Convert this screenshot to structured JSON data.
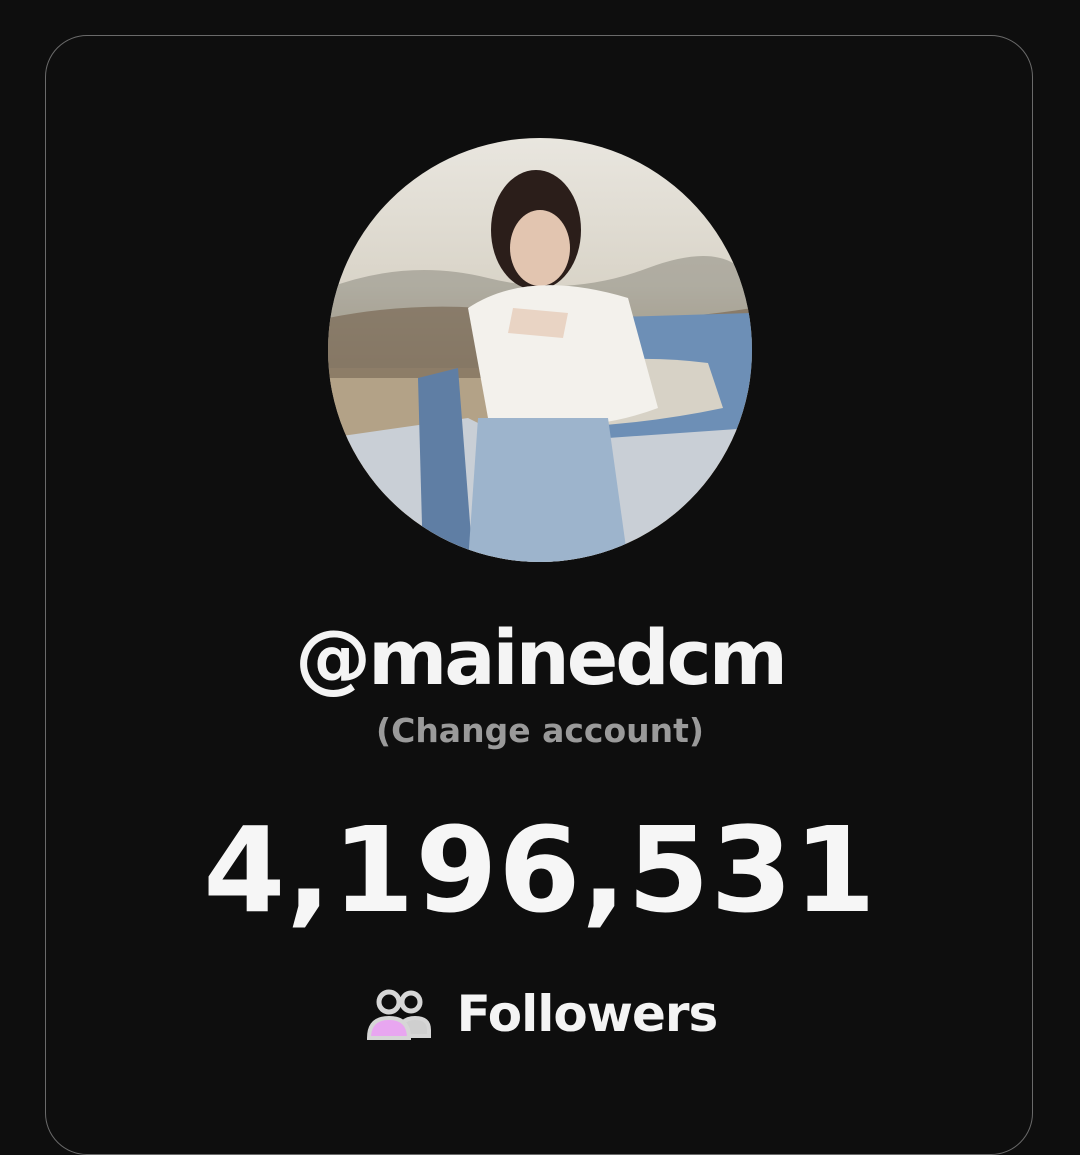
{
  "profile": {
    "username": "@mainedcm",
    "change_account_label": "(Change account)",
    "avatar_icon": "profile-photo"
  },
  "stats": {
    "followers_count": "4,196,531",
    "followers_label": "Followers",
    "followers_icon": "users-icon"
  },
  "colors": {
    "background": "#0e0e0e",
    "card_border": "#6a6a6a",
    "text_primary": "#f4f4f4",
    "text_secondary": "#9a9a9a",
    "icon_accent": "#e8a6f0"
  }
}
